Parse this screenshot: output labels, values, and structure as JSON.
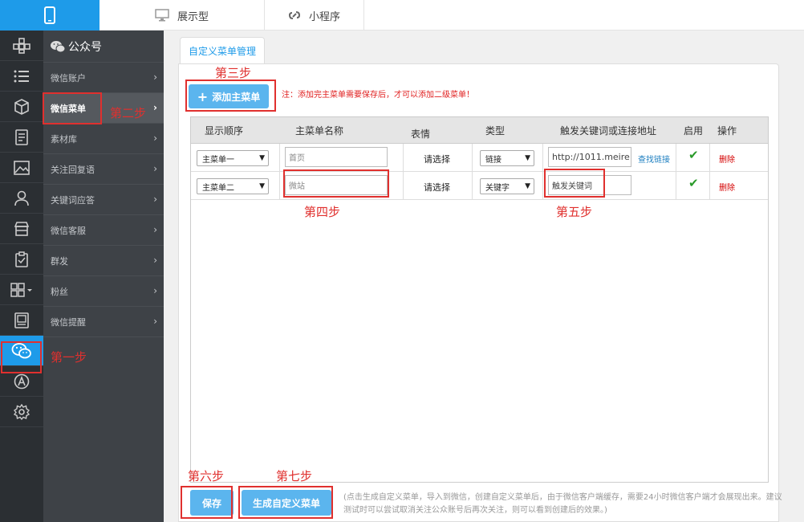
{
  "top": {
    "tabs": [
      {
        "label": "展示型",
        "icon": "monitor-icon"
      },
      {
        "label": "小程序",
        "icon": "link-icon"
      }
    ]
  },
  "icon_rail": [
    "grid-plus-icon",
    "list-icon",
    "cube-icon",
    "document-icon",
    "image-icon",
    "user-icon",
    "store-icon",
    "clipboard-icon",
    "apps-icon",
    "photo-frame-icon",
    "wechat-icon",
    "app-store-icon",
    "settings-icon"
  ],
  "sidebar": {
    "header": "公众号",
    "items": [
      {
        "label": "微信账户"
      },
      {
        "label": "微信菜单"
      },
      {
        "label": "素材库"
      },
      {
        "label": "关注回复语"
      },
      {
        "label": "关键词应答"
      },
      {
        "label": "微信客服"
      },
      {
        "label": "群发"
      },
      {
        "label": "粉丝"
      },
      {
        "label": "微信提醒"
      }
    ]
  },
  "main": {
    "tab": "自定义菜单管理",
    "add_button": "添加主菜单",
    "note": "注：添加完主菜单需要保存后，才可以添加二级菜单！",
    "columns": [
      "显示顺序",
      "主菜单名称",
      "表情",
      "类型",
      "触发关键词或连接地址",
      "启用",
      "操作"
    ],
    "rows": [
      {
        "order": "主菜单一",
        "name": "首页",
        "emoji": "请选择",
        "type": "链接",
        "target": "http://1011.meire",
        "extra_link": "查找链接",
        "enabled": "✔",
        "action": "删除"
      },
      {
        "order": "主菜单二",
        "name": "微站",
        "emoji": "请选择",
        "type": "关键字",
        "target": "触发关键词",
        "extra_link": "",
        "enabled": "✔",
        "action": "删除"
      }
    ],
    "save_button": "保存",
    "generate_button": "生成自定义菜单",
    "hint": "(点击生成自定义菜单，导入到微信，创建自定义菜单后，由于微信客户端缓存，需要24小时微信客户端才会展现出来。建议测试时可以尝试取消关注公众账号后再次关注，则可以看到创建后的效果。)"
  },
  "steps": {
    "s1": "第一步",
    "s2": "第二步",
    "s3": "第三步",
    "s4": "第四步",
    "s5": "第五步",
    "s6": "第六步",
    "s7": "第七步"
  },
  "colors": {
    "accent": "#1e9be9",
    "button": "#5bb5ee",
    "annotation": "#e0302e",
    "sidebar": "#3e4247",
    "rail": "#2b2f33"
  }
}
